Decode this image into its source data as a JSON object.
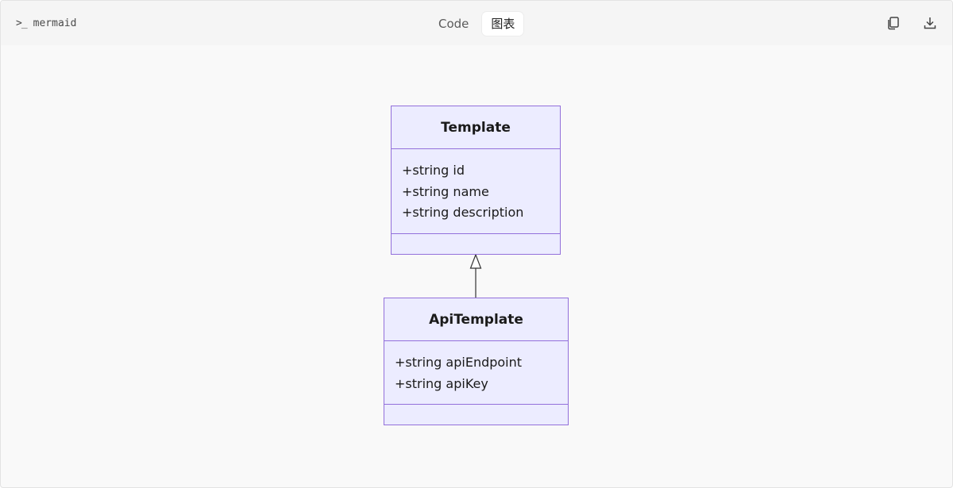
{
  "header": {
    "language_icon": "terminal-prompt-icon",
    "language": "mermaid",
    "tabs": [
      {
        "label": "Code",
        "active": false
      },
      {
        "label": "图表",
        "active": true
      }
    ],
    "actions": [
      "copy-icon",
      "download-icon"
    ]
  },
  "diagram": {
    "classes": [
      {
        "name": "Template",
        "attributes": [
          "+string id",
          "+string name",
          "+string description"
        ],
        "methods": []
      },
      {
        "name": "ApiTemplate",
        "attributes": [
          "+string apiEndpoint",
          "+string apiKey"
        ],
        "methods": []
      }
    ],
    "relations": [
      {
        "from": "ApiTemplate",
        "to": "Template",
        "type": "inheritance"
      }
    ],
    "colors": {
      "fill": "#ececff",
      "stroke": "#9370db",
      "line": "#333333"
    }
  }
}
